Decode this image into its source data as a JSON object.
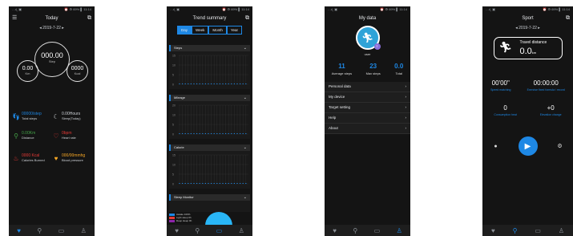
{
  "status_left": "…ıl ຸ ▣",
  "status_right": "⏰ ⚙ 69% ▌ 11:14",
  "screen1": {
    "title": "Today",
    "date": "2019-7-22",
    "center_value": "000.00",
    "center_label": "Step",
    "left_value": "0.00",
    "left_unit": "Km",
    "right_value": "0000",
    "right_unit": "Kcal",
    "stats": [
      {
        "icon": "footsteps-icon",
        "value": "00000/step",
        "label": "Total steps",
        "color": "#1e88e5"
      },
      {
        "icon": "moon-icon",
        "value": "0.00Hours",
        "label": "Sleep(Today)",
        "color": "#cfd3d8"
      },
      {
        "icon": "location-icon",
        "value": "0.00Km",
        "label": "Distance",
        "color": "#43a047"
      },
      {
        "icon": "heart-icon",
        "value": "0bpm",
        "label": "Heart rate",
        "color": "#e53935"
      },
      {
        "icon": "flame-icon",
        "value": "0000 Kcal",
        "label": "Calories Burned",
        "color": "#e53935"
      },
      {
        "icon": "blood-pressure-icon",
        "value": "000/00mmhg",
        "label": "Blood pressure",
        "color": "#f9a825"
      }
    ]
  },
  "screen2": {
    "title": "Trend summary",
    "tabs": [
      "Day",
      "Week",
      "Month",
      "Year"
    ],
    "selected_tab": "Day",
    "charts": [
      {
        "label": "Steps",
        "ticks": [
          "15",
          "10",
          "5",
          "0"
        ]
      },
      {
        "label": "Mileage",
        "ticks": [
          "20",
          "10",
          "5",
          "0"
        ]
      },
      {
        "label": "Calorie",
        "ticks": [
          "15",
          "10",
          "5",
          "0"
        ]
      }
    ],
    "sleep_label": "Sleep Monitor",
    "legend": [
      {
        "label": "Awake 100%",
        "color": "#1e88e5"
      },
      {
        "label": "Light sleep 0h",
        "color": "#e53935"
      },
      {
        "label": "Deep sleep 0h",
        "color": "#8e24aa"
      }
    ]
  },
  "screen3": {
    "title": "My data",
    "username": "user",
    "stats": [
      {
        "value": "11",
        "label": "Average steps"
      },
      {
        "value": "23",
        "label": "Max steps"
      },
      {
        "value": "0.0",
        "label": "Total"
      }
    ],
    "menu": [
      "Personal data",
      "My device",
      "Target setting",
      "Help",
      "About"
    ]
  },
  "screen4": {
    "title": "Sport",
    "date": "2019-7-22",
    "travel_label": "Travel distance",
    "travel_value": "0.0",
    "travel_unit": "km",
    "row1": [
      {
        "value": "00'00\"",
        "label": "Speed matching"
      },
      {
        "value": "00:00:00",
        "label": "Exercise fixed formula / record"
      }
    ],
    "row2": [
      {
        "value": "0",
        "label": "Consumption heat"
      },
      {
        "value": "+0",
        "label": "Elevation change"
      }
    ]
  },
  "colors": {
    "accent": "#1e88e5",
    "bg": "#141414"
  }
}
